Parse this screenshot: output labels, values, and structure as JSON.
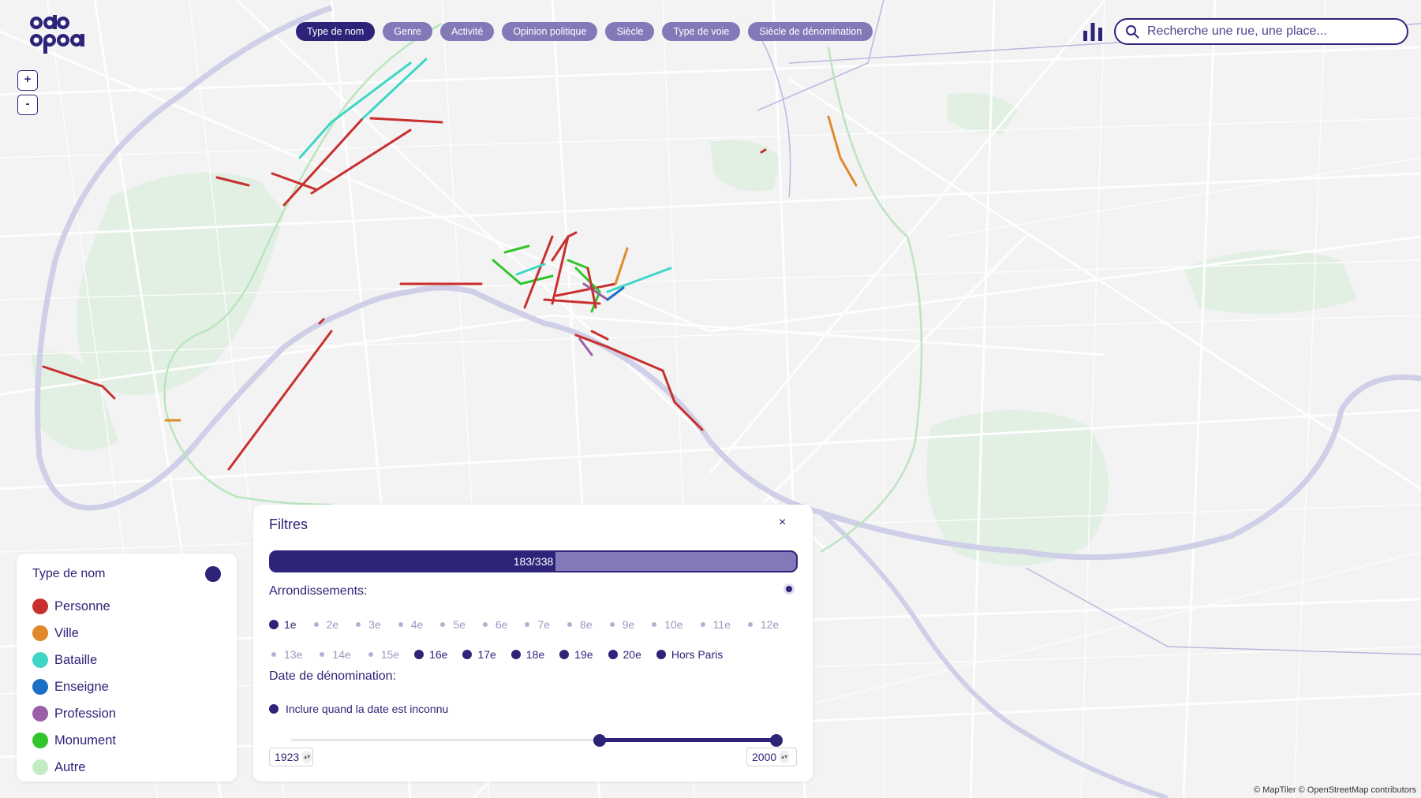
{
  "logo": {
    "line1": "odo",
    "line2": "capa"
  },
  "top_filters": [
    {
      "label": "Type de nom",
      "active": true
    },
    {
      "label": "Genre",
      "active": false
    },
    {
      "label": "Activité",
      "active": false
    },
    {
      "label": "Opinion politique",
      "active": false
    },
    {
      "label": "Siècle",
      "active": false
    },
    {
      "label": "Type de voie",
      "active": false
    },
    {
      "label": "Siècle de dénomination",
      "active": false
    }
  ],
  "search": {
    "placeholder": "Recherche une rue, une place..."
  },
  "zoom": {
    "in_label": "+",
    "out_label": "-"
  },
  "legend": {
    "title": "Type de nom",
    "items": [
      {
        "label": "Personne",
        "color": "#c8302e"
      },
      {
        "label": "Ville",
        "color": "#e0892b"
      },
      {
        "label": "Bataille",
        "color": "#3fd6c8"
      },
      {
        "label": "Enseigne",
        "color": "#1b6fc6"
      },
      {
        "label": "Profession",
        "color": "#9a5fa8"
      },
      {
        "label": "Monument",
        "color": "#31c42b"
      },
      {
        "label": "Autre",
        "color": "#c4ecc4"
      }
    ]
  },
  "filters": {
    "title": "Filtres",
    "close_label": "×",
    "progress": {
      "label": "183/338",
      "count": 183,
      "total": 338
    },
    "arrondissements_label": "Arrondissements:",
    "arrondissements": [
      {
        "label": "1e",
        "selected": true
      },
      {
        "label": "2e",
        "selected": false
      },
      {
        "label": "3e",
        "selected": false
      },
      {
        "label": "4e",
        "selected": false
      },
      {
        "label": "5e",
        "selected": false
      },
      {
        "label": "6e",
        "selected": false
      },
      {
        "label": "7e",
        "selected": false
      },
      {
        "label": "8e",
        "selected": false
      },
      {
        "label": "9e",
        "selected": false
      },
      {
        "label": "10e",
        "selected": false
      },
      {
        "label": "11e",
        "selected": false
      },
      {
        "label": "12e",
        "selected": false
      },
      {
        "label": "13e",
        "selected": false
      },
      {
        "label": "14e",
        "selected": false
      },
      {
        "label": "15e",
        "selected": false
      },
      {
        "label": "16e",
        "selected": true
      },
      {
        "label": "17e",
        "selected": true
      },
      {
        "label": "18e",
        "selected": true
      },
      {
        "label": "19e",
        "selected": true
      },
      {
        "label": "20e",
        "selected": true
      },
      {
        "label": "Hors Paris",
        "selected": true
      }
    ],
    "date_label": "Date de dénomination:",
    "include_unknown_label": "Inclure quand la date est inconnu",
    "date_range": {
      "min": 1789,
      "max": 2000,
      "from": 1923,
      "to": 2000
    }
  },
  "map": {
    "attribution": "© MapTiler © OpenStreetMap contributors",
    "colors": {
      "water": "#cfd0e8",
      "park": "#e0efe2",
      "road": "#ffffff",
      "rail": "#b9b8de"
    }
  }
}
